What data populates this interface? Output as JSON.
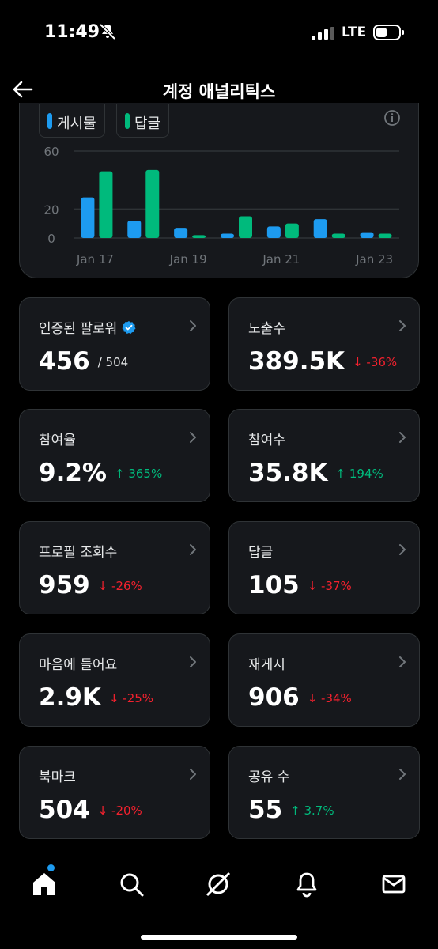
{
  "status_bar": {
    "time": "11:49",
    "network": "LTE"
  },
  "header": {
    "title": "계정 애널리틱스"
  },
  "colors": {
    "posts": "#1d9bf0",
    "replies": "#00ba7c",
    "down": "#f4212e",
    "up": "#00ba7c"
  },
  "chart_data": {
    "type": "bar",
    "x_labels": [
      "Jan 17",
      "Jan 19",
      "Jan 21",
      "Jan 23"
    ],
    "categories": [
      "Jan 17",
      "Jan 18",
      "Jan 19",
      "Jan 20",
      "Jan 21",
      "Jan 22",
      "Jan 23"
    ],
    "series": [
      {
        "name": "게시물",
        "color": "#1d9bf0",
        "values": [
          28,
          12,
          7,
          3,
          8,
          13,
          4
        ]
      },
      {
        "name": "답글",
        "color": "#00ba7c",
        "values": [
          46,
          47,
          2,
          15,
          10,
          3,
          3
        ]
      }
    ],
    "yticks": [
      0,
      20,
      60
    ],
    "ylim": [
      0,
      70
    ],
    "grid": true
  },
  "metrics": [
    {
      "label": "인증된 팔로워",
      "value": "456",
      "sub": "/ 504",
      "change": "",
      "dir": "",
      "verified": true
    },
    {
      "label": "노출수",
      "value": "389.5K",
      "sub": "",
      "change": "↓ -36%",
      "dir": "down",
      "verified": false
    },
    {
      "label": "참여율",
      "value": "9.2%",
      "sub": "",
      "change": "↑ 365%",
      "dir": "up",
      "verified": false
    },
    {
      "label": "참여수",
      "value": "35.8K",
      "sub": "",
      "change": "↑ 194%",
      "dir": "up",
      "verified": false
    },
    {
      "label": "프로필 조회수",
      "value": "959",
      "sub": "",
      "change": "↓ -26%",
      "dir": "down",
      "verified": false
    },
    {
      "label": "답글",
      "value": "105",
      "sub": "",
      "change": "↓ -37%",
      "dir": "down",
      "verified": false
    },
    {
      "label": "마음에 들어요",
      "value": "2.9K",
      "sub": "",
      "change": "↓ -25%",
      "dir": "down",
      "verified": false
    },
    {
      "label": "재게시",
      "value": "906",
      "sub": "",
      "change": "↓ -34%",
      "dir": "down",
      "verified": false
    },
    {
      "label": "북마크",
      "value": "504",
      "sub": "",
      "change": "↓ -20%",
      "dir": "down",
      "verified": false
    },
    {
      "label": "공유 수",
      "value": "55",
      "sub": "",
      "change": "↑ 3.7%",
      "dir": "up",
      "verified": false
    }
  ],
  "nav": [
    {
      "id": "home",
      "icon": "home-icon"
    },
    {
      "id": "search",
      "icon": "search-icon"
    },
    {
      "id": "grok",
      "icon": "grok-icon"
    },
    {
      "id": "notifications",
      "icon": "bell-icon"
    },
    {
      "id": "messages",
      "icon": "mail-icon"
    }
  ]
}
